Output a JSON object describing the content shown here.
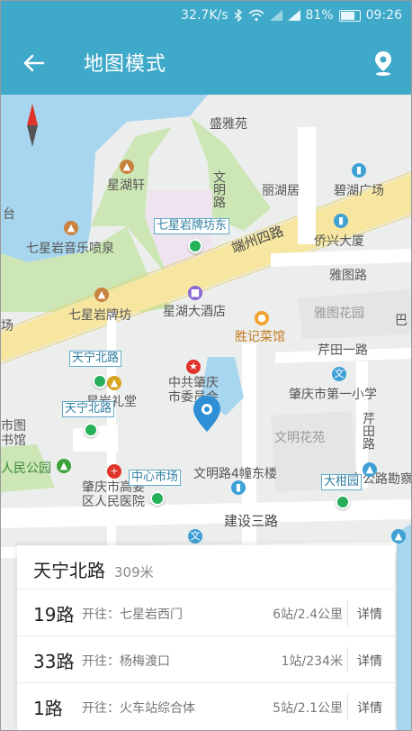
{
  "status": {
    "speed": "32.7K/s",
    "battery": "81%",
    "battery_level": 0.81,
    "time": "09:26",
    "icons": [
      "bluetooth-icon",
      "wifi-icon",
      "signal-icon",
      "signal-icon",
      "battery-icon"
    ]
  },
  "appbar": {
    "title": "地图模式",
    "back_icon": "back-arrow-icon",
    "location_icon": "location-pin-icon"
  },
  "map": {
    "labels": {
      "shengya": "盛雅苑",
      "xingfu": "星湖轩",
      "wenming_road": "文明路",
      "lihuju": "丽湖居",
      "biyuan": "碧湖广场",
      "tai": "台",
      "qixingyan_fountain": "七星岩音乐喷泉",
      "duanzhou_road4": "端州四路",
      "qiaoxing": "侨兴大厦",
      "yatu_road": "雅图路",
      "qixingyan_arch": "七星岩牌坊",
      "xinghu_hotel": "星湖大酒店",
      "yatu_garden": "雅图花园",
      "shengji": "胜记菜馆",
      "qiantian_road1": "芹田一路",
      "cpc": "中共肇庆市委员会",
      "yanbei_class": "星岩礼堂",
      "no1_primary": "肇庆市第一小学",
      "qiantian_road": "芹田路",
      "wenming_garden": "文明花苑",
      "shi_library": "市图书馆",
      "people_park": "人民公园",
      "hospital": "肇庆市高要区人民医院",
      "wenming_road4": "文明路4幢东楼",
      "highway_design": "市公路勘察设计院",
      "jianshe_road3": "建设三路",
      "chang": "场",
      "bo": "巴"
    },
    "stops": {
      "qixingyan_paifang": "七星岩牌坊东",
      "tianning_north_1": "天宁北路",
      "tianning_north_2": "天宁北路",
      "zhongxin_market": "中心市场",
      "dagan": "大柑园"
    }
  },
  "panel": {
    "stop_name": "天宁北路",
    "distance": "309米",
    "routes": [
      {
        "name": "19路",
        "dest": "开往：七星岩西门",
        "info": "6站/2.4公里",
        "detail": "详情"
      },
      {
        "name": "33路",
        "dest": "开往：杨梅渡口",
        "info": "1站/234米",
        "detail": "详情"
      },
      {
        "name": "1路",
        "dest": "开往：火车站综合体",
        "info": "5站/2.1公里",
        "detail": "详情"
      }
    ]
  },
  "colors": {
    "appbar": "#3fa9c9",
    "water": "#a9d6ef",
    "park": "#cde6b5",
    "road": "#f6e6a0",
    "stop_green": "#26b05a"
  }
}
